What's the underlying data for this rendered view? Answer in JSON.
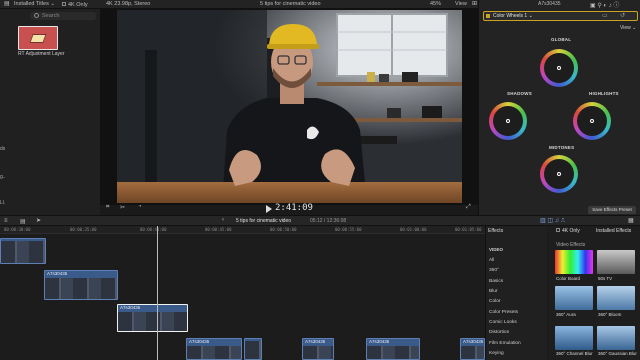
{
  "top_bar": {
    "browser_dropdown": "Installed Titles ⌄",
    "filter_4k": "4K Only",
    "clip_info": "4K 23.98p, Stereo",
    "project_title": "5 tips for cinematic video",
    "zoom": "45%",
    "view_menu": "View"
  },
  "browser": {
    "search_placeholder": "Search",
    "item_label": "RT Adjustment Layer",
    "edge_chars": [
      "ds",
      "g..",
      "LI."
    ]
  },
  "viewer": {
    "timecode": "2:41:09"
  },
  "inspector": {
    "clip_name": "A7s30435",
    "effect_selector": "Color Wheels 1 ⌄",
    "view_menu": "View ⌄",
    "wheels": [
      "GLOBAL",
      "SHADOWS",
      "HIGHLIGHTS",
      "MIDTONES"
    ],
    "save_button": "Save Effects Preset"
  },
  "timeline": {
    "index_title": "5 tips for cinematic video",
    "duration": "05:12 / 12:36:08",
    "ruler_ticks": [
      "00:00:30:00",
      "00:00:35:00",
      "00:00:40:00",
      "00:00:45:00",
      "00:00:50:00",
      "00:00:55:00",
      "00:01:00:00",
      "00:01:05:00"
    ],
    "clips": [
      "A7s30435",
      "A7s30435",
      "A7s30435",
      "A7s30435",
      "A7s30435",
      "A7s30435"
    ]
  },
  "effects": {
    "panel_title": "Effects",
    "filter_4k": "4K Only",
    "installed": "Installed Effects",
    "section_title": "Video Effects",
    "categories": [
      "VIDEO",
      "All",
      "360°",
      "Basics",
      "Blur",
      "Color",
      "Color Presets",
      "Comic Looks",
      "Distortion",
      "Film Emulation",
      "Keying"
    ],
    "items": [
      "Color Board",
      "50s TV",
      "360° Aura",
      "360° Bloom",
      "360° Channel Blur",
      "360° Gaussian Blur"
    ]
  },
  "colors": {
    "accent": "#c9a227",
    "clip_blue": "#3a5a8a",
    "selection": "#f2f2f2",
    "wall": "#2b2e33",
    "desk": "#8a5a33"
  }
}
